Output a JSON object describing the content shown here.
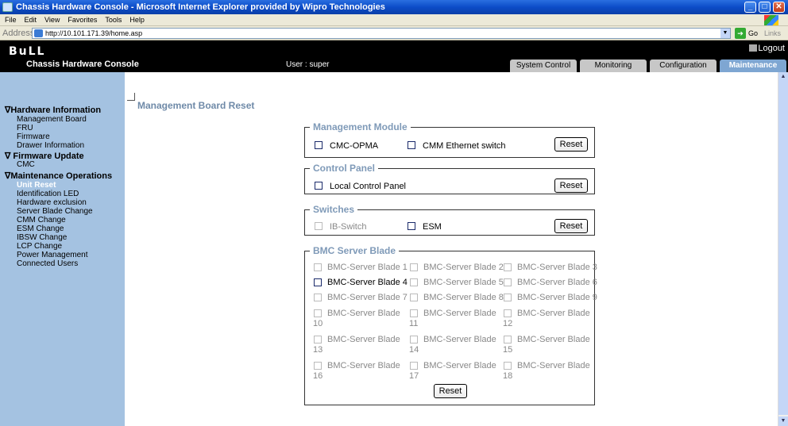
{
  "window": {
    "title": "Chassis Hardware Console - Microsoft Internet Explorer provided by Wipro Technologies"
  },
  "menu": [
    "File",
    "Edit",
    "View",
    "Favorites",
    "Tools",
    "Help"
  ],
  "address": {
    "label": "Address",
    "url": "http://10.101.171.39/home.asp",
    "go": "Go",
    "links": "Links"
  },
  "header": {
    "logo": "BuLL",
    "app_name": "Chassis Hardware Console",
    "user": "User : super",
    "logout": "Logout"
  },
  "tabs": [
    "System Control",
    "Monitoring",
    "Configuration",
    "Maintenance"
  ],
  "active_tab": "Maintenance",
  "sidebar": {
    "sections": [
      {
        "title": "∇Hardware Information",
        "items": [
          "Management Board",
          "FRU",
          "Firmware",
          "Drawer Information"
        ]
      },
      {
        "title": "∇ Firmware Update",
        "items": [
          "CMC"
        ]
      },
      {
        "title": "∇Maintenance Operations",
        "items": [
          "Unit Reset",
          "Identification LED",
          "Hardware exclusion",
          "Server Blade Change",
          "CMM Change",
          "ESM Change",
          "IBSW Change",
          "LCP Change",
          "Power Management",
          "Connected Users"
        ]
      }
    ],
    "active_item": "Unit Reset"
  },
  "page_title": "Management Board Reset",
  "groups": {
    "mgmt": {
      "legend": "Management Module",
      "opt1": "CMC-OPMA",
      "opt2": "CMM Ethernet switch",
      "reset": "Reset"
    },
    "panel": {
      "legend": "Control Panel",
      "opt1": "Local Control Panel",
      "reset": "Reset"
    },
    "switches": {
      "legend": "Switches",
      "opt1": "IB-Switch",
      "opt2": "ESM",
      "reset": "Reset"
    },
    "bmc": {
      "legend": "BMC Server Blade",
      "reset": "Reset",
      "blades": [
        {
          "label": "BMC-Server Blade 1",
          "enabled": false
        },
        {
          "label": "BMC-Server Blade 2",
          "enabled": false
        },
        {
          "label": "BMC-Server Blade 3",
          "enabled": false
        },
        {
          "label": "BMC-Server Blade 4",
          "enabled": true
        },
        {
          "label": "BMC-Server Blade 5",
          "enabled": false
        },
        {
          "label": "BMC-Server Blade 6",
          "enabled": false
        },
        {
          "label": "BMC-Server Blade 7",
          "enabled": false
        },
        {
          "label": "BMC-Server Blade 8",
          "enabled": false
        },
        {
          "label": "BMC-Server Blade 9",
          "enabled": false
        },
        {
          "label": "BMC-Server Blade",
          "num": "10",
          "enabled": false
        },
        {
          "label": "BMC-Server Blade",
          "num": "11",
          "enabled": false
        },
        {
          "label": "BMC-Server Blade",
          "num": "12",
          "enabled": false
        },
        {
          "label": "BMC-Server Blade",
          "num": "13",
          "enabled": false
        },
        {
          "label": "BMC-Server Blade",
          "num": "14",
          "enabled": false
        },
        {
          "label": "BMC-Server Blade",
          "num": "15",
          "enabled": false
        },
        {
          "label": "BMC-Server Blade",
          "num": "16",
          "enabled": false
        },
        {
          "label": "BMC-Server Blade",
          "num": "17",
          "enabled": false
        },
        {
          "label": "BMC-Server Blade",
          "num": "18",
          "enabled": false
        }
      ]
    }
  },
  "colors": {
    "sidebar": "#a4c2e1",
    "active_tab": "#7ea6d2",
    "legend": "#7f9ab8",
    "header": "#000000"
  }
}
